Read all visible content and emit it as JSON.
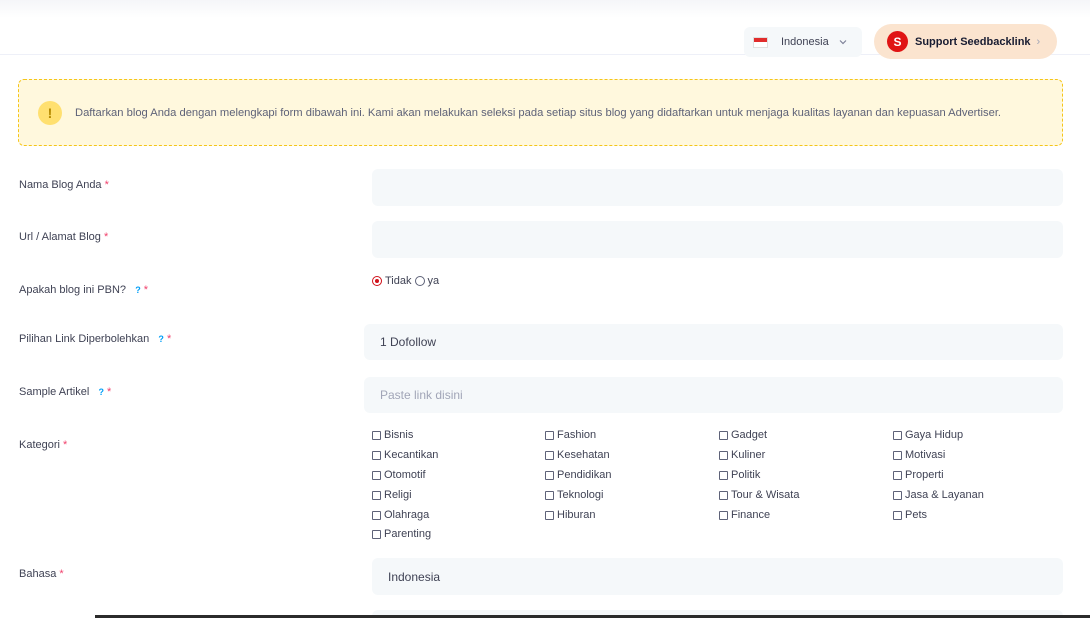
{
  "header": {
    "language": "Indonesia",
    "support_label": "Support Seedbacklink",
    "support_logo_letter": "S"
  },
  "alert": {
    "icon": "!",
    "text": "Daftarkan blog Anda dengan melengkapi form dibawah ini. Kami akan melakukan seleksi pada setiap situs blog yang didaftarkan untuk menjaga kualitas layanan dan kepuasan Advertiser."
  },
  "form": {
    "blog_name": {
      "label": "Nama Blog Anda",
      "required": "*",
      "value": ""
    },
    "blog_url": {
      "label": "Url / Alamat Blog",
      "required": "*",
      "value": ""
    },
    "pbn": {
      "label": "Apakah blog ini PBN?",
      "help": "?",
      "required": "*",
      "options": [
        "Tidak",
        "ya"
      ],
      "selected": "Tidak"
    },
    "link_type": {
      "label": "Pilihan Link Diperbolehkan",
      "help": "?",
      "required": "*",
      "value": "1 Dofollow"
    },
    "sample": {
      "label": "Sample Artikel",
      "help": "?",
      "required": "*",
      "placeholder": "Paste link disini"
    },
    "category": {
      "label": "Kategori",
      "required": "*",
      "options": [
        "Bisnis",
        "Fashion",
        "Gadget",
        "Gaya Hidup",
        "Kecantikan",
        "Kesehatan",
        "Kuliner",
        "Motivasi",
        "Otomotif",
        "Pendidikan",
        "Politik",
        "Properti",
        "Religi",
        "Teknologi",
        "Tour & Wisata",
        "Jasa & Layanan",
        "Olahraga",
        "Hiburan",
        "Finance",
        "Pets",
        "Parenting"
      ]
    },
    "language": {
      "label": "Bahasa",
      "required": "*",
      "value": "Indonesia"
    }
  }
}
